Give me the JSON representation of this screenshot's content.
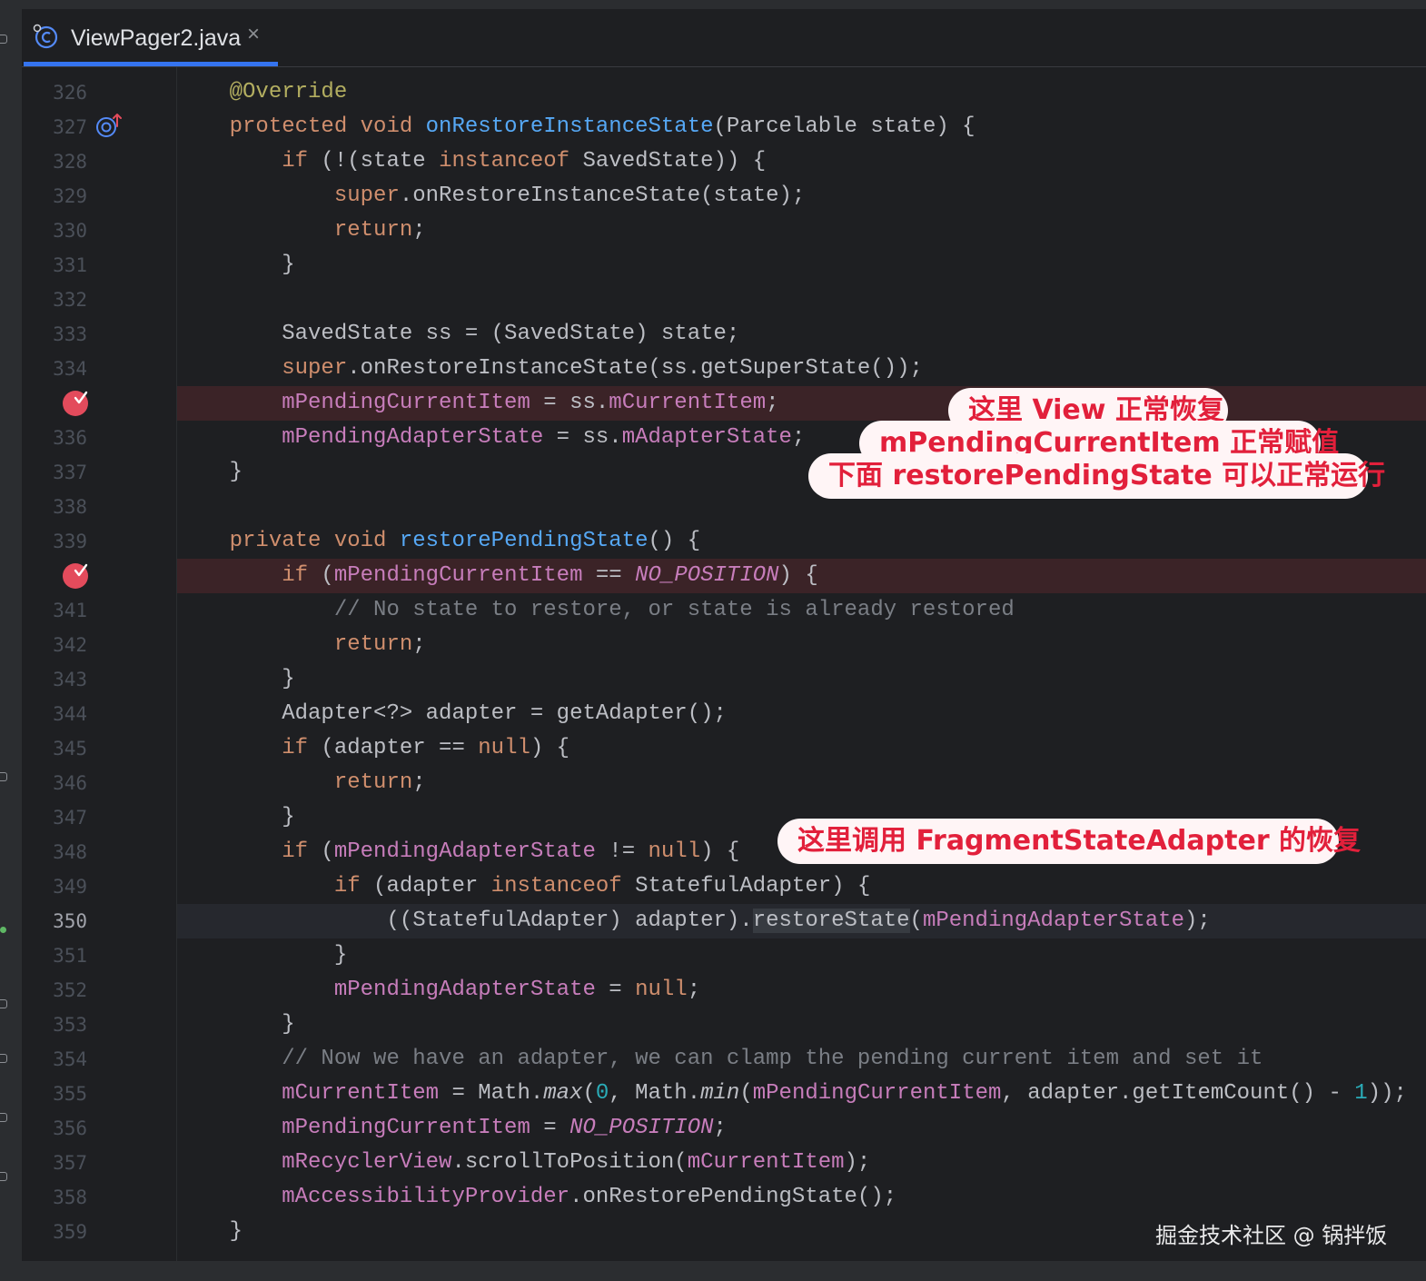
{
  "tab": {
    "file_name": "ViewPager2.java",
    "close_glyph": "×"
  },
  "editor": {
    "lines": [
      {
        "number": "326",
        "tokens": [
          {
            "t": "    "
          },
          {
            "t": "@Override",
            "c": "ann"
          }
        ]
      },
      {
        "number": "327",
        "gutter_icon": "override-marker-icon",
        "tokens": [
          {
            "t": "    "
          },
          {
            "t": "protected void ",
            "c": "kw"
          },
          {
            "t": "onRestoreInstanceState",
            "c": "fn"
          },
          {
            "t": "(Parcelable state) {"
          }
        ]
      },
      {
        "number": "328",
        "tokens": [
          {
            "t": "        "
          },
          {
            "t": "if",
            "c": "kw"
          },
          {
            "t": " (!(state "
          },
          {
            "t": "instanceof",
            "c": "kw"
          },
          {
            "t": " SavedState)) {"
          }
        ]
      },
      {
        "number": "329",
        "tokens": [
          {
            "t": "            "
          },
          {
            "t": "super",
            "c": "kw"
          },
          {
            "t": ".onRestoreInstanceState(state);"
          }
        ]
      },
      {
        "number": "330",
        "tokens": [
          {
            "t": "            "
          },
          {
            "t": "return",
            "c": "kw"
          },
          {
            "t": ";"
          }
        ]
      },
      {
        "number": "331",
        "tokens": [
          {
            "t": "        }"
          }
        ]
      },
      {
        "number": "332",
        "tokens": []
      },
      {
        "number": "333",
        "tokens": [
          {
            "t": "        SavedState ss = (SavedState) state;"
          }
        ]
      },
      {
        "number": "334",
        "tokens": [
          {
            "t": "        "
          },
          {
            "t": "super",
            "c": "kw"
          },
          {
            "t": ".onRestoreInstanceState(ss.getSuperState());"
          }
        ]
      },
      {
        "number": "",
        "breakpoint": true,
        "tokens": [
          {
            "t": "        "
          },
          {
            "t": "mPendingCurrentItem",
            "c": "fld"
          },
          {
            "t": " = ss."
          },
          {
            "t": "mCurrentItem",
            "c": "fld"
          },
          {
            "t": ";"
          }
        ]
      },
      {
        "number": "336",
        "tokens": [
          {
            "t": "        "
          },
          {
            "t": "mPendingAdapterState",
            "c": "fld"
          },
          {
            "t": " = ss."
          },
          {
            "t": "mAdapterState",
            "c": "fld"
          },
          {
            "t": ";"
          }
        ]
      },
      {
        "number": "337",
        "tokens": [
          {
            "t": "    }"
          }
        ]
      },
      {
        "number": "338",
        "tokens": []
      },
      {
        "number": "339",
        "tokens": [
          {
            "t": "    "
          },
          {
            "t": "private void ",
            "c": "kw"
          },
          {
            "t": "restorePendingState",
            "c": "fn"
          },
          {
            "t": "() {"
          }
        ]
      },
      {
        "number": "",
        "breakpoint": true,
        "tokens": [
          {
            "t": "        "
          },
          {
            "t": "if",
            "c": "kw"
          },
          {
            "t": " ("
          },
          {
            "t": "mPendingCurrentItem",
            "c": "fld"
          },
          {
            "t": " == "
          },
          {
            "t": "NO_POSITION",
            "c": "const"
          },
          {
            "t": ") {"
          }
        ]
      },
      {
        "number": "341",
        "tokens": [
          {
            "t": "            "
          },
          {
            "t": "// No state to restore, or state is already restored",
            "c": "cm"
          }
        ]
      },
      {
        "number": "342",
        "tokens": [
          {
            "t": "            "
          },
          {
            "t": "return",
            "c": "kw"
          },
          {
            "t": ";"
          }
        ]
      },
      {
        "number": "343",
        "tokens": [
          {
            "t": "        }"
          }
        ]
      },
      {
        "number": "344",
        "tokens": [
          {
            "t": "        Adapter<?> adapter = getAdapter();"
          }
        ]
      },
      {
        "number": "345",
        "tokens": [
          {
            "t": "        "
          },
          {
            "t": "if",
            "c": "kw"
          },
          {
            "t": " (adapter == "
          },
          {
            "t": "null",
            "c": "kw"
          },
          {
            "t": ") {"
          }
        ]
      },
      {
        "number": "346",
        "tokens": [
          {
            "t": "            "
          },
          {
            "t": "return",
            "c": "kw"
          },
          {
            "t": ";"
          }
        ]
      },
      {
        "number": "347",
        "tokens": [
          {
            "t": "        }"
          }
        ]
      },
      {
        "number": "348",
        "tokens": [
          {
            "t": "        "
          },
          {
            "t": "if",
            "c": "kw"
          },
          {
            "t": " ("
          },
          {
            "t": "mPendingAdapterState",
            "c": "fld"
          },
          {
            "t": " != "
          },
          {
            "t": "null",
            "c": "kw"
          },
          {
            "t": ") {"
          }
        ]
      },
      {
        "number": "349",
        "tokens": [
          {
            "t": "            "
          },
          {
            "t": "if",
            "c": "kw"
          },
          {
            "t": " (adapter "
          },
          {
            "t": "instanceof",
            "c": "kw"
          },
          {
            "t": " StatefulAdapter) {"
          }
        ]
      },
      {
        "number": "350",
        "current": true,
        "tokens": [
          {
            "t": "                ((StatefulAdapter) adapter)."
          },
          {
            "t": "restoreState",
            "c": "sel"
          },
          {
            "t": "("
          },
          {
            "t": "mPendingAdapterState",
            "c": "fld"
          },
          {
            "t": ");"
          }
        ]
      },
      {
        "number": "351",
        "tokens": [
          {
            "t": "            }"
          }
        ]
      },
      {
        "number": "352",
        "tokens": [
          {
            "t": "            "
          },
          {
            "t": "mPendingAdapterState",
            "c": "fld"
          },
          {
            "t": " = "
          },
          {
            "t": "null",
            "c": "kw"
          },
          {
            "t": ";"
          }
        ]
      },
      {
        "number": "353",
        "tokens": [
          {
            "t": "        }"
          }
        ]
      },
      {
        "number": "354",
        "tokens": [
          {
            "t": "        "
          },
          {
            "t": "// Now we have an adapter, we can clamp the pending current item and set it",
            "c": "cm"
          }
        ]
      },
      {
        "number": "355",
        "tokens": [
          {
            "t": "        "
          },
          {
            "t": "mCurrentItem",
            "c": "fld"
          },
          {
            "t": " = Math."
          },
          {
            "t": "max",
            "c": "it"
          },
          {
            "t": "("
          },
          {
            "t": "0",
            "c": "num"
          },
          {
            "t": ", Math."
          },
          {
            "t": "min",
            "c": "it"
          },
          {
            "t": "("
          },
          {
            "t": "mPendingCurrentItem",
            "c": "fld"
          },
          {
            "t": ", adapter.getItemCount() - "
          },
          {
            "t": "1",
            "c": "num"
          },
          {
            "t": "));"
          }
        ]
      },
      {
        "number": "356",
        "tokens": [
          {
            "t": "        "
          },
          {
            "t": "mPendingCurrentItem",
            "c": "fld"
          },
          {
            "t": " = "
          },
          {
            "t": "NO_POSITION",
            "c": "const"
          },
          {
            "t": ";"
          }
        ]
      },
      {
        "number": "357",
        "tokens": [
          {
            "t": "        "
          },
          {
            "t": "mRecyclerView",
            "c": "fld"
          },
          {
            "t": ".scrollToPosition("
          },
          {
            "t": "mCurrentItem",
            "c": "fld"
          },
          {
            "t": ");"
          }
        ]
      },
      {
        "number": "358",
        "tokens": [
          {
            "t": "        "
          },
          {
            "t": "mAccessibilityProvider",
            "c": "fld"
          },
          {
            "t": ".onRestorePendingState();"
          }
        ]
      },
      {
        "number": "359",
        "tokens": [
          {
            "t": "    }"
          }
        ]
      }
    ]
  },
  "annotations": {
    "restore_line1": "这里 View 正常恢复",
    "restore_line2": "mPendingCurrentItem 正常赋值",
    "restore_line3": "下面 restorePendingState 可以正常运行",
    "adapter_note": "这里调用 FragmentStateAdapter 的恢复"
  },
  "watermark": "掘金技术社区 @ 锅拌饭",
  "colors": {
    "background": "#1e1f22",
    "keyword": "#cf8e6d",
    "method": "#56a8f5",
    "field": "#c77dbb",
    "comment": "#7a7e85",
    "breakpoint": "#e34b5c",
    "annotation_text": "#e2203b",
    "annotation_bg": "#fff5f6",
    "tab_underline": "#3574f0"
  }
}
